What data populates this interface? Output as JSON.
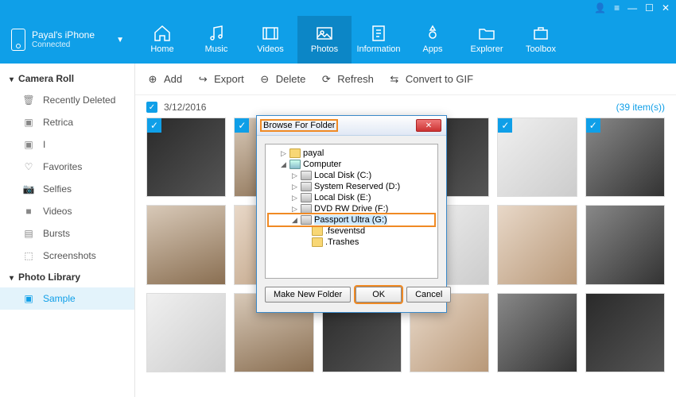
{
  "titlebar": {
    "user_icon": "👤"
  },
  "device": {
    "name": "Payal's iPhone",
    "status": "Connected"
  },
  "nav": [
    {
      "label": "Home",
      "icon": "home"
    },
    {
      "label": "Music",
      "icon": "music"
    },
    {
      "label": "Videos",
      "icon": "video"
    },
    {
      "label": "Photos",
      "icon": "photo",
      "active": true
    },
    {
      "label": "Information",
      "icon": "info"
    },
    {
      "label": "Apps",
      "icon": "apps"
    },
    {
      "label": "Explorer",
      "icon": "explorer"
    },
    {
      "label": "Toolbox",
      "icon": "toolbox"
    }
  ],
  "sidebar": {
    "section1": "Camera Roll",
    "items1": [
      {
        "label": "Recently Deleted",
        "icon": "trash"
      },
      {
        "label": "Retrica",
        "icon": "image"
      },
      {
        "label": "I",
        "icon": "image"
      },
      {
        "label": "Favorites",
        "icon": "heart"
      },
      {
        "label": "Selfies",
        "icon": "camera"
      },
      {
        "label": "Videos",
        "icon": "vcam"
      },
      {
        "label": "Bursts",
        "icon": "burst"
      },
      {
        "label": "Screenshots",
        "icon": "screen"
      }
    ],
    "section2": "Photo Library",
    "items2": [
      {
        "label": "Sample",
        "icon": "image",
        "active": true
      }
    ]
  },
  "toolbar": {
    "add": "Add",
    "export": "Export",
    "delete": "Delete",
    "refresh": "Refresh",
    "gif": "Convert to GIF"
  },
  "content": {
    "date": "3/12/2016",
    "count": "(39 item(s))"
  },
  "dialog": {
    "title": "Browse For Folder",
    "tree": [
      {
        "indent": 1,
        "exp": "▷",
        "icon": "folder",
        "label": "payal"
      },
      {
        "indent": 1,
        "exp": "◢",
        "icon": "comp",
        "label": "Computer"
      },
      {
        "indent": 2,
        "exp": "▷",
        "icon": "drive",
        "label": "Local Disk (C:)"
      },
      {
        "indent": 2,
        "exp": "▷",
        "icon": "drive",
        "label": "System Reserved (D:)"
      },
      {
        "indent": 2,
        "exp": "▷",
        "icon": "drive",
        "label": "Local Disk (E:)"
      },
      {
        "indent": 2,
        "exp": "▷",
        "icon": "drive",
        "label": "DVD RW Drive (F:)"
      },
      {
        "indent": 2,
        "exp": "◢",
        "icon": "drive",
        "label": "Passport Ultra (G:)",
        "selected": true
      },
      {
        "indent": 3,
        "exp": "",
        "icon": "folder",
        "label": ".fseventsd"
      },
      {
        "indent": 3,
        "exp": "",
        "icon": "folder",
        "label": ".Trashes"
      }
    ],
    "make_folder": "Make New Folder",
    "ok": "OK",
    "cancel": "Cancel"
  }
}
